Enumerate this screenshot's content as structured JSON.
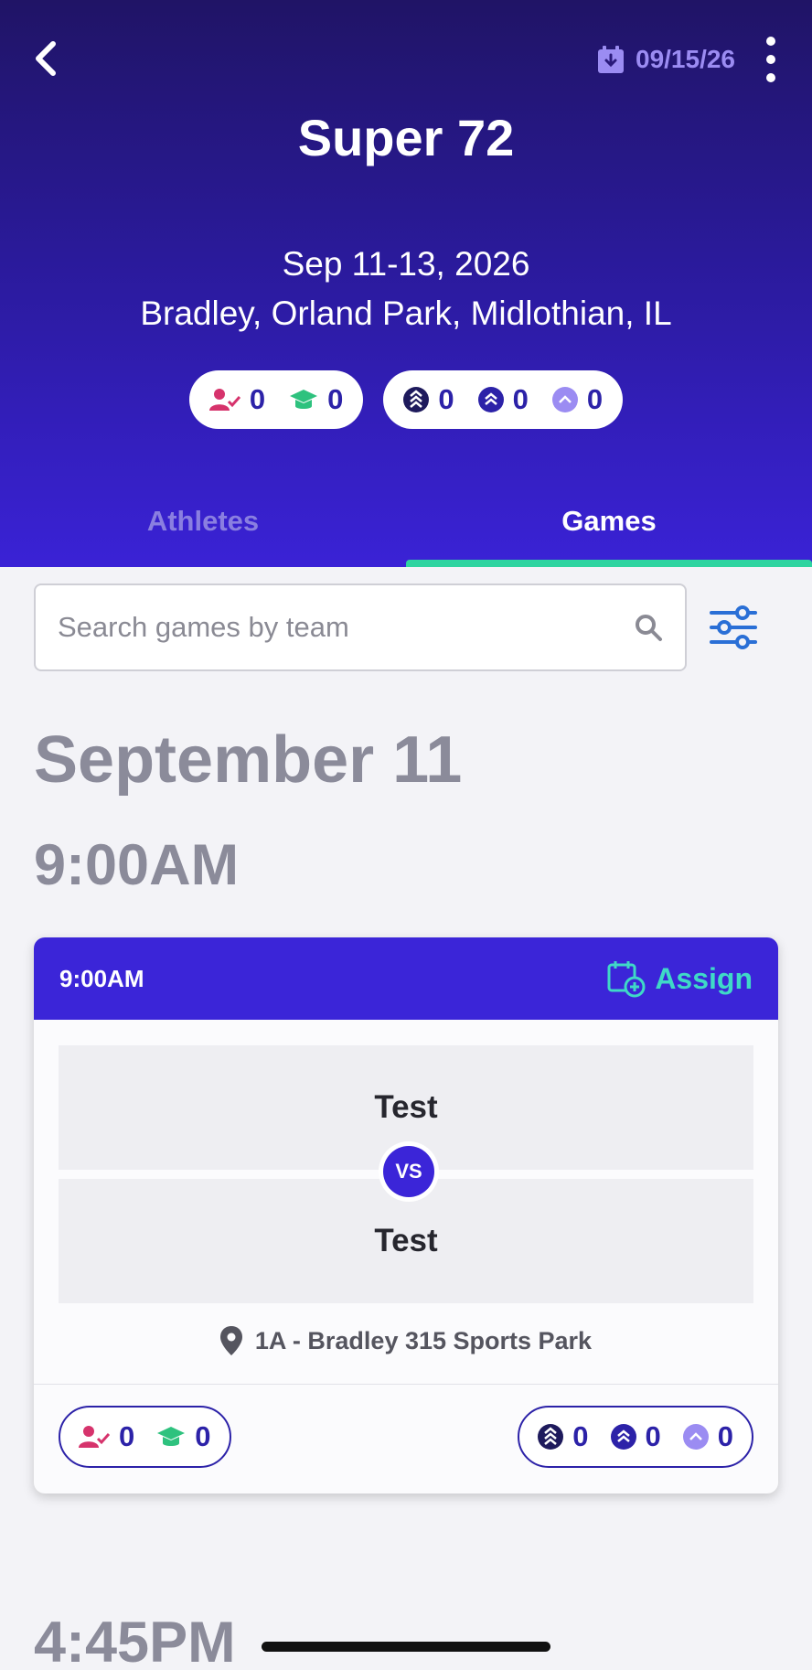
{
  "header": {
    "date_chip": "09/15/26",
    "title": "Super 72",
    "dates": "Sep 11-13, 2026",
    "location": "Bradley, Orland Park, Midlothian, IL",
    "stats_people": [
      {
        "icon": "user-check-icon",
        "value": "0",
        "color": "#d6336c"
      },
      {
        "icon": "graduation-cap-icon",
        "value": "0",
        "color": "#2ec27e"
      }
    ],
    "stats_levels": [
      {
        "icon": "level-high-icon",
        "value": "0"
      },
      {
        "icon": "level-mid-icon",
        "value": "0"
      },
      {
        "icon": "level-low-icon",
        "value": "0"
      }
    ]
  },
  "tabs": [
    {
      "label": "Athletes",
      "active": false
    },
    {
      "label": "Games",
      "active": true
    }
  ],
  "search": {
    "placeholder": "Search games by team",
    "value": ""
  },
  "schedule": {
    "date_heading": "September 11",
    "time_groups": [
      "9:00AM",
      "4:45PM"
    ]
  },
  "game_card": {
    "time": "9:00AM",
    "assign_label": "Assign",
    "team_a": "Test",
    "team_b": "Test",
    "vs_label": "VS",
    "venue": "1A - Bradley 315 Sports Park",
    "people": [
      "0",
      "0"
    ],
    "levels": [
      "0",
      "0",
      "0"
    ]
  },
  "colors": {
    "header_top": "#201466",
    "header_bottom": "#3a22d6",
    "accent": "#3b25d8",
    "tab_indicator": "#2ed4a0",
    "assign": "#3fd9c7"
  }
}
